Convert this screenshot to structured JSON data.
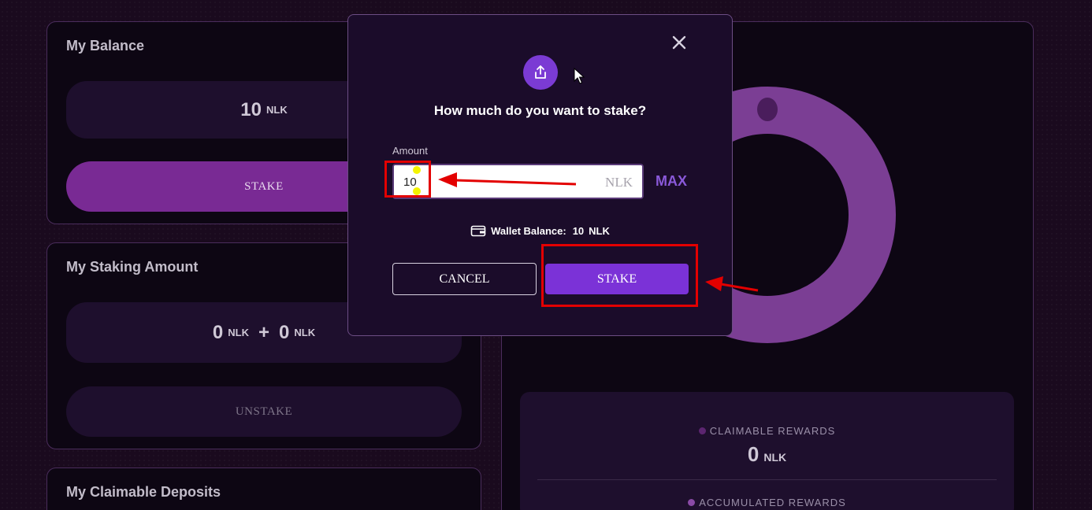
{
  "balance": {
    "title": "My Balance",
    "value": "10",
    "unit": "NLK",
    "stake_label": "STAKE"
  },
  "staking": {
    "title": "My Staking Amount",
    "value_a": "0",
    "unit_a": "NLK",
    "plus": "+",
    "value_b": "0",
    "unit_b": "NLK",
    "unstake_label": "UNSTAKE"
  },
  "deposits": {
    "title": "My Claimable Deposits"
  },
  "rewards": {
    "claimable_label": "CLAIMABLE REWARDS",
    "claimable_value": "0",
    "claimable_unit": "NLK",
    "accumulated_label": "ACCUMULATED REWARDS"
  },
  "modal": {
    "title": "How much do you want to stake?",
    "amount_label": "Amount",
    "amount_value": "10",
    "amount_unit": "NLK",
    "max_label": "MAX",
    "wallet_label": "Wallet Balance:",
    "wallet_value": "10",
    "wallet_unit": "NLK",
    "cancel_label": "CANCEL",
    "stake_label": "STAKE"
  },
  "colors": {
    "accent": "#7b32d7",
    "donut": "#7b3e94",
    "annotation": "#e30000"
  },
  "icons": [
    "close-icon",
    "share-upload-icon",
    "wallet-icon",
    "mouse-cursor-icon"
  ]
}
